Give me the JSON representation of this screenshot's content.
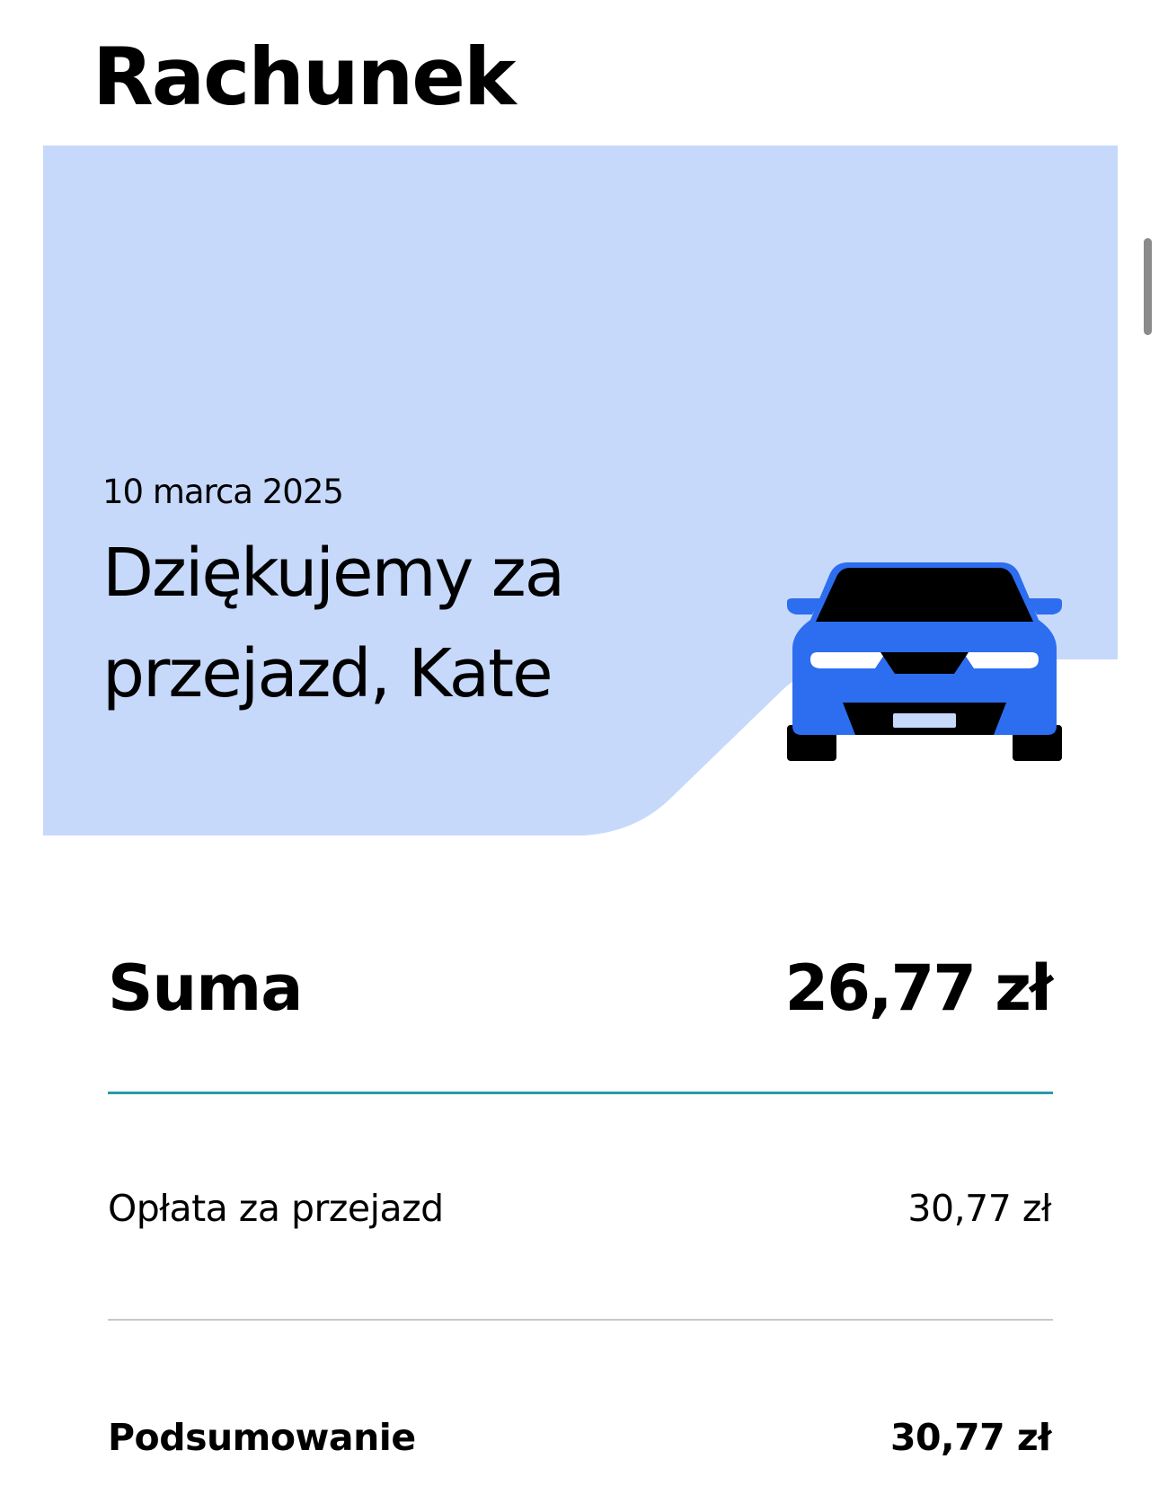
{
  "header": {
    "title": "Rachunek"
  },
  "hero": {
    "date": "10 marca 2025",
    "thanks": "Dziękujemy za przejazd, Kate",
    "background_color": "#c6d9fb",
    "illustration": "car-icon",
    "car_color": "#2d6df0"
  },
  "receipt": {
    "total": {
      "label": "Suma",
      "value": "26,77 zł"
    },
    "accent_divider_color": "#2b9aa6",
    "fare": {
      "label": "Opłata za przejazd",
      "value": "30,77 zł"
    },
    "summary": {
      "label": "Podsumowanie",
      "value": "30,77 zł"
    }
  }
}
